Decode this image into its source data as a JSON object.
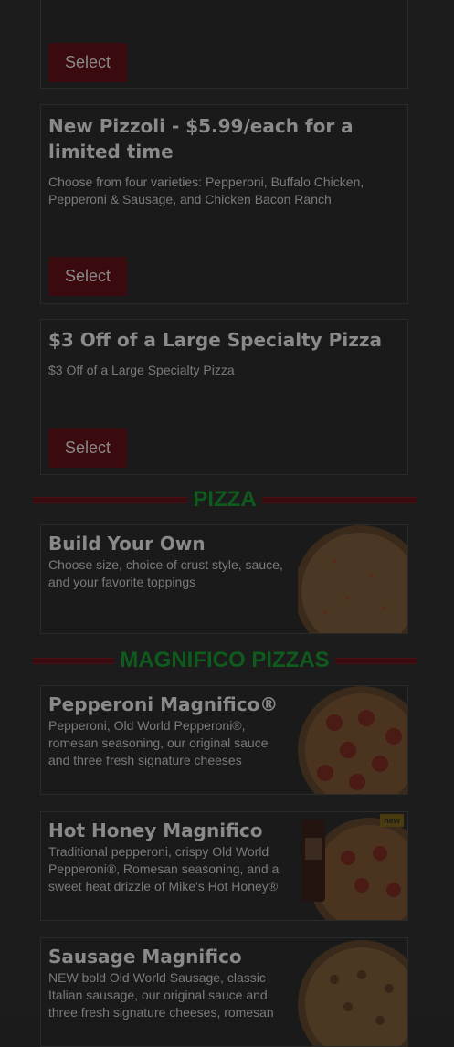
{
  "deals": [
    {
      "title": "",
      "description": "",
      "button": "Select"
    },
    {
      "title": "New Pizzoli - $5.99/each for a limited time",
      "description": "Choose from four varieties: Pepperoni, Buffalo Chicken, Pepperoni & Sausage, and Chicken Bacon Ranch",
      "button": "Select"
    },
    {
      "title": "$3 Off of a Large Specialty Pizza",
      "description": "$3 Off of a Large Specialty Pizza",
      "button": "Select"
    }
  ],
  "sections": {
    "pizza": "PIZZA",
    "magnifico": "MAGNIFICO PIZZAS"
  },
  "pizzas": [
    {
      "title": "Build Your Own",
      "description": "Choose size, choice of crust style, sauce, and your favorite toppings"
    }
  ],
  "magnifico": [
    {
      "title": "Pepperoni Magnifico®",
      "description": "Pepperoni, Old World Pepperoni®, romesan seasoning, our original sauce and three fresh signature cheeses"
    },
    {
      "title": "Hot Honey Magnifico",
      "description": "Traditional pepperoni, crispy Old World Pepperoni®, Romesan seasoning, and a sweet heat drizzle of Mike's Hot Honey®",
      "badge": "new"
    },
    {
      "title": "Sausage Magnifico",
      "description": "NEW bold Old World Sausage, classic Italian sausage, our original sauce and three fresh signature cheeses, romesan"
    }
  ],
  "colors": {
    "accent_red": "#3b0a0e",
    "section_green": "#0f5a1d",
    "background": "#1c1c1c"
  }
}
